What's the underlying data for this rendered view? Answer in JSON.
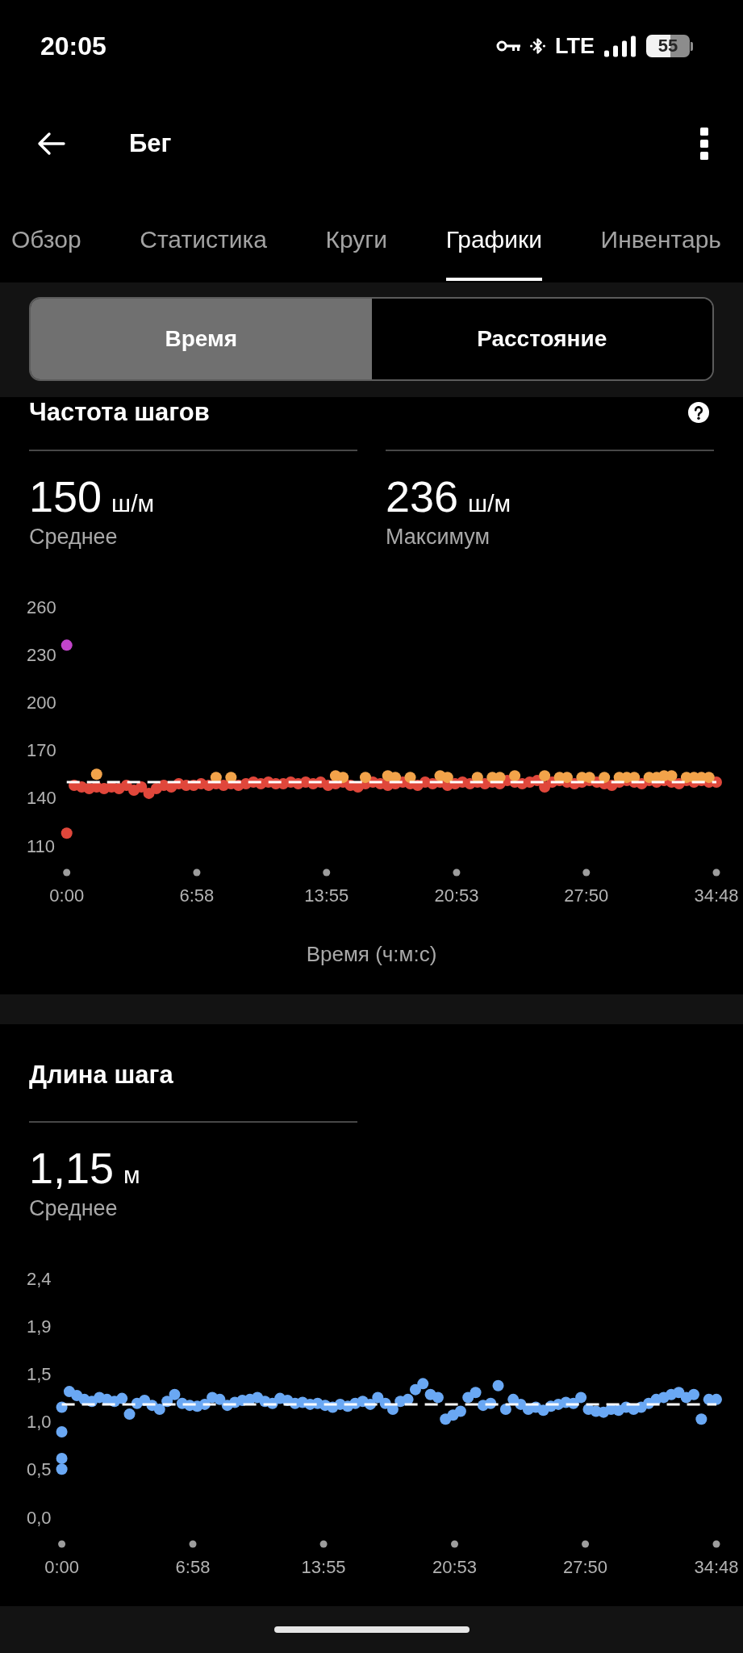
{
  "status_bar": {
    "time": "20:05",
    "network": "LTE",
    "battery": "55"
  },
  "header": {
    "title": "Бег"
  },
  "tabs": [
    {
      "label": "Обзор",
      "selected": false
    },
    {
      "label": "Статистика",
      "selected": false
    },
    {
      "label": "Круги",
      "selected": false
    },
    {
      "label": "Графики",
      "selected": true
    },
    {
      "label": "Инвентарь",
      "selected": false
    }
  ],
  "segments": [
    {
      "label": "Время",
      "selected": true
    },
    {
      "label": "Расстояние",
      "selected": false
    }
  ],
  "sections": [
    {
      "title": "Частота шагов",
      "help_icon": true,
      "stats": [
        {
          "value": "150",
          "unit": "ш/м",
          "label": "Среднее"
        },
        {
          "value": "236",
          "unit": "ш/м",
          "label": "Максимум"
        }
      ],
      "chart_data": {
        "type": "scatter",
        "xlabel": "Время (ч:м:с)",
        "x": [
          0,
          24,
          48,
          72,
          96,
          120,
          144,
          168,
          192,
          216,
          240,
          264,
          288,
          312,
          336,
          360,
          384,
          408,
          432,
          456,
          480,
          504,
          528,
          552,
          576,
          600,
          624,
          648,
          672,
          696,
          720,
          744,
          768,
          792,
          816,
          840,
          864,
          888,
          912,
          936,
          960,
          984,
          1008,
          1032,
          1056,
          1080,
          1104,
          1128,
          1152,
          1176,
          1200,
          1224,
          1248,
          1272,
          1296,
          1320,
          1344,
          1368,
          1392,
          1416,
          1440,
          1464,
          1488,
          1512,
          1536,
          1560,
          1584,
          1608,
          1632,
          1656,
          1680,
          1704,
          1728,
          1752,
          1776,
          1800,
          1824,
          1848,
          1872,
          1896,
          1920,
          1944,
          1968,
          1992,
          2016,
          2040,
          2064,
          2088
        ],
        "series": [
          {
            "color": "#e0473b",
            "values": [
              118,
              148,
              147,
              146,
              147,
              146,
              147,
              146,
              148,
              145,
              147,
              143,
              146,
              148,
              147,
              149,
              148,
              148,
              149,
              148,
              149,
              148,
              149,
              148,
              149,
              150,
              149,
              150,
              149,
              149,
              150,
              149,
              150,
              149,
              150,
              148,
              149,
              150,
              148,
              147,
              149,
              150,
              149,
              148,
              149,
              150,
              149,
              148,
              150,
              149,
              150,
              148,
              149,
              150,
              149,
              150,
              149,
              150,
              149,
              151,
              150,
              149,
              150,
              151,
              147,
              150,
              151,
              150,
              149,
              150,
              151,
              150,
              149,
              148,
              150,
              151,
              150,
              149,
              151,
              150,
              151,
              150,
              149,
              151,
              150,
              151,
              150,
              150
            ]
          },
          {
            "color": "#f2a34a",
            "values": [
              null,
              null,
              null,
              null,
              155,
              null,
              null,
              null,
              null,
              null,
              null,
              null,
              null,
              null,
              null,
              null,
              null,
              null,
              null,
              null,
              153,
              null,
              153,
              null,
              null,
              null,
              null,
              null,
              null,
              null,
              null,
              null,
              null,
              null,
              null,
              null,
              154,
              153,
              null,
              null,
              153,
              null,
              null,
              154,
              153,
              null,
              153,
              null,
              null,
              null,
              154,
              153,
              null,
              null,
              null,
              153,
              null,
              153,
              153,
              null,
              154,
              null,
              null,
              null,
              154,
              null,
              153,
              153,
              null,
              153,
              153,
              null,
              153,
              null,
              153,
              153,
              153,
              null,
              153,
              153,
              154,
              154,
              null,
              153,
              153,
              153,
              153,
              null
            ]
          },
          {
            "color": "#c244cb",
            "values": [
              236,
              null,
              null,
              null,
              null,
              null,
              null,
              null,
              null,
              null,
              null,
              null,
              null,
              null,
              null,
              null,
              null,
              null,
              null,
              null,
              null,
              null,
              null,
              null,
              null,
              null,
              null,
              null,
              null,
              null,
              null,
              null,
              null,
              null,
              null,
              null,
              null,
              null,
              null,
              null,
              null,
              null,
              null,
              null,
              null,
              null,
              null,
              null,
              null,
              null,
              null,
              null,
              null,
              null,
              null,
              null,
              null,
              null,
              null,
              null,
              null,
              null,
              null,
              null,
              null,
              null,
              null,
              null,
              null,
              null,
              null,
              null,
              null,
              null,
              null,
              null,
              null,
              null,
              null,
              null,
              null,
              null,
              null,
              null,
              null,
              null,
              null,
              null
            ]
          }
        ],
        "xlim": [
          0,
          2088
        ],
        "ylim": [
          110,
          260
        ],
        "xticks": [
          {
            "value": 0,
            "label": "0:00"
          },
          {
            "value": 418,
            "label": "6:58"
          },
          {
            "value": 835,
            "label": "13:55"
          },
          {
            "value": 1253,
            "label": "20:53"
          },
          {
            "value": 1670,
            "label": "27:50"
          },
          {
            "value": 2088,
            "label": "34:48"
          }
        ],
        "yticks": [
          110,
          140,
          170,
          200,
          230,
          260
        ],
        "ref_lines": [
          {
            "axis": "y",
            "value": 150
          }
        ]
      }
    },
    {
      "title": "Длина шага",
      "help_icon": false,
      "stats": [
        {
          "value": "1,15",
          "unit": "м",
          "label": "Среднее"
        }
      ],
      "chart_data": {
        "type": "scatter",
        "x": [
          0,
          0,
          0,
          0,
          24,
          48,
          72,
          96,
          120,
          144,
          168,
          192,
          216,
          240,
          264,
          288,
          312,
          336,
          360,
          384,
          408,
          432,
          456,
          480,
          504,
          528,
          552,
          576,
          600,
          624,
          648,
          672,
          696,
          720,
          744,
          768,
          792,
          816,
          840,
          864,
          888,
          912,
          936,
          960,
          984,
          1008,
          1032,
          1056,
          1080,
          1104,
          1128,
          1152,
          1176,
          1200,
          1224,
          1248,
          1272,
          1296,
          1320,
          1344,
          1368,
          1392,
          1416,
          1440,
          1464,
          1488,
          1512,
          1536,
          1560,
          1584,
          1608,
          1632,
          1656,
          1680,
          1704,
          1728,
          1752,
          1776,
          1800,
          1824,
          1848,
          1872,
          1896,
          1920,
          1944,
          1968,
          1992,
          2016,
          2040,
          2064,
          2088
        ],
        "series": [
          {
            "color": "#6aa8f4",
            "values": [
              0.49,
              0.6,
              0.87,
              1.12,
              1.28,
              1.24,
              1.2,
              1.18,
              1.22,
              1.2,
              1.18,
              1.21,
              1.05,
              1.16,
              1.19,
              1.14,
              1.1,
              1.18,
              1.25,
              1.16,
              1.14,
              1.13,
              1.15,
              1.22,
              1.2,
              1.14,
              1.17,
              1.19,
              1.2,
              1.22,
              1.18,
              1.16,
              1.21,
              1.19,
              1.16,
              1.17,
              1.15,
              1.16,
              1.14,
              1.12,
              1.15,
              1.13,
              1.16,
              1.18,
              1.15,
              1.22,
              1.16,
              1.1,
              1.18,
              1.2,
              1.3,
              1.36,
              1.25,
              1.22,
              1.0,
              1.04,
              1.08,
              1.22,
              1.27,
              1.14,
              1.16,
              1.34,
              1.1,
              1.2,
              1.15,
              1.1,
              1.12,
              1.09,
              1.13,
              1.15,
              1.17,
              1.16,
              1.22,
              1.1,
              1.08,
              1.07,
              1.1,
              1.09,
              1.12,
              1.1,
              1.12,
              1.16,
              1.2,
              1.22,
              1.25,
              1.27,
              1.22,
              1.25,
              1.0,
              1.2,
              1.2
            ]
          }
        ],
        "xlim": [
          0,
          2088
        ],
        "ylim": [
          0,
          2.43
        ],
        "xticks": [
          {
            "value": 0,
            "label": "0:00"
          },
          {
            "value": 418,
            "label": "6:58"
          },
          {
            "value": 835,
            "label": "13:55"
          },
          {
            "value": 1253,
            "label": "20:53"
          },
          {
            "value": 1670,
            "label": "27:50"
          },
          {
            "value": 2088,
            "label": "34:48"
          }
        ],
        "yticks": [
          {
            "value": 0,
            "label": "0,0"
          },
          {
            "value": 0.49,
            "label": "0,5"
          },
          {
            "value": 0.97,
            "label": "1,0"
          },
          {
            "value": 1.46,
            "label": "1,5"
          },
          {
            "value": 1.94,
            "label": "1,9"
          },
          {
            "value": 2.43,
            "label": "2,4"
          }
        ],
        "ref_lines": [
          {
            "axis": "y",
            "value": 1.15
          }
        ]
      }
    }
  ]
}
